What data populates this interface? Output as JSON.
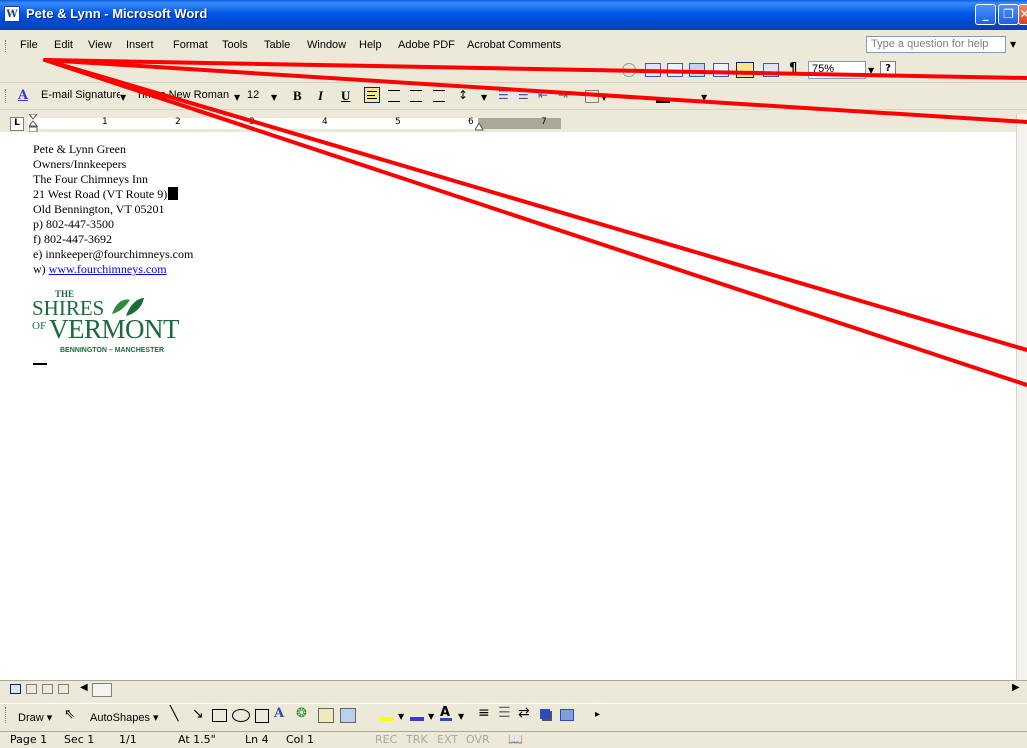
{
  "window": {
    "title": "Pete & Lynn - Microsoft Word",
    "app_icon": "W"
  },
  "menubar": {
    "items": [
      "File",
      "Edit",
      "View",
      "Insert",
      "Format",
      "Tools",
      "Table",
      "Window",
      "Help",
      "Adobe PDF",
      "Acrobat Comments"
    ],
    "help_placeholder": "Type a question for help"
  },
  "standard_toolbar": {
    "zoom": "75%"
  },
  "formatting_toolbar": {
    "style": "E-mail Signature",
    "font": "Times New Roman",
    "font_size": "12",
    "bold": "B",
    "italic": "I",
    "underline": "U"
  },
  "ruler": {
    "numbers": [
      "1",
      "2",
      "3",
      "4",
      "5",
      "6",
      "7"
    ]
  },
  "document": {
    "lines": [
      "Pete & Lynn Green",
      "Owners/Innkeepers",
      "The Four Chimneys Inn",
      "21 West Road (VT Route 9)",
      "Old Bennington, VT 05201",
      "p) 802-447-3500",
      "f) 802-447-3692",
      "e) innkeeper@fourchimneys.com"
    ],
    "web_prefix": "w) ",
    "web_link": "www.fourchimneys.com",
    "logo": {
      "the": "THE",
      "shires": "SHIRES",
      "of": "OF",
      "vermont": "VERMONT",
      "tagline": "BENNINGTON – MANCHESTER"
    }
  },
  "drawing_toolbar": {
    "draw": "Draw",
    "autoshapes": "AutoShapes"
  },
  "statusbar": {
    "page": "Page 1",
    "sec": "Sec 1",
    "pages": "1/1",
    "at": "At 1.5\"",
    "ln": "Ln 4",
    "col": "Col 1",
    "rec": "REC",
    "trk": "TRK",
    "ext": "EXT",
    "ovr": "OVR"
  },
  "colors": {
    "annotation": "#ff0000",
    "logo_green": "#1b6a3a",
    "link": "#0000ff"
  }
}
